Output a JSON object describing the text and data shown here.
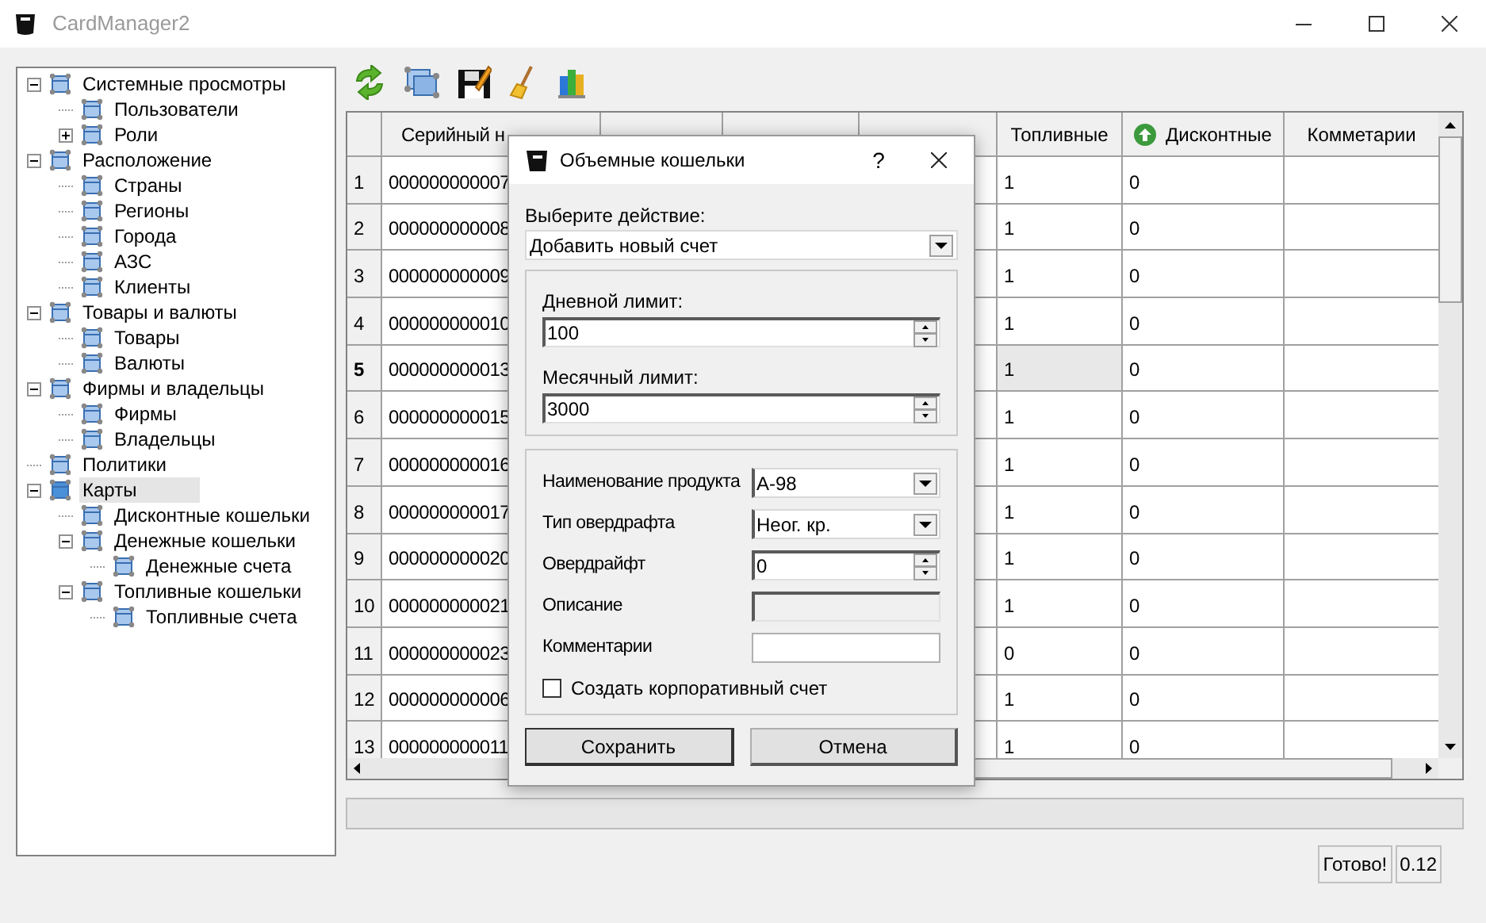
{
  "window": {
    "title": "CardManager2"
  },
  "tree": [
    {
      "label": "Системные просмотры",
      "expanded": true,
      "selected": false,
      "children": [
        {
          "label": "Пользователи",
          "selected": false
        },
        {
          "label": "Роли",
          "expanded": false,
          "selected": false
        }
      ]
    },
    {
      "label": "Расположение",
      "expanded": true,
      "selected": false,
      "children": [
        {
          "label": "Страны",
          "selected": false
        },
        {
          "label": "Регионы",
          "selected": false
        },
        {
          "label": "Города",
          "selected": false
        },
        {
          "label": "АЗС",
          "selected": false
        },
        {
          "label": "Клиенты",
          "selected": false
        }
      ]
    },
    {
      "label": "Товары и валюты",
      "expanded": true,
      "selected": false,
      "children": [
        {
          "label": "Товары",
          "selected": false
        },
        {
          "label": "Валюты",
          "selected": false
        }
      ]
    },
    {
      "label": "Фирмы и владельцы",
      "expanded": true,
      "selected": false,
      "children": [
        {
          "label": "Фирмы",
          "selected": false
        },
        {
          "label": "Владельцы",
          "selected": false
        }
      ]
    },
    {
      "label": "Политики",
      "selected": false
    },
    {
      "label": "Карты",
      "expanded": true,
      "selected": true,
      "children": [
        {
          "label": "Дисконтные кошельки",
          "selected": false
        },
        {
          "label": "Денежные кошельки",
          "expanded": true,
          "selected": false,
          "children": [
            {
              "label": "Денежные счета",
              "selected": false
            }
          ]
        },
        {
          "label": "Топливные кошельки",
          "expanded": true,
          "selected": false,
          "children": [
            {
              "label": "Топливные счета",
              "selected": false
            }
          ]
        }
      ]
    }
  ],
  "table": {
    "columns": [
      {
        "label": "Серийный н",
        "sorted": false
      },
      {
        "label": "Топливные",
        "sorted": false
      },
      {
        "label": "Дисконтные",
        "sorted": true
      },
      {
        "label": "Комметарии",
        "sorted": false
      }
    ],
    "rows": [
      {
        "number": "1",
        "serial": "000000000007",
        "fuel": "1",
        "discount": "0",
        "current": false
      },
      {
        "number": "2",
        "serial": "000000000008",
        "fuel": "1",
        "discount": "0",
        "current": false
      },
      {
        "number": "3",
        "serial": "000000000009",
        "fuel": "1",
        "discount": "0",
        "current": false
      },
      {
        "number": "4",
        "serial": "000000000010",
        "fuel": "1",
        "discount": "0",
        "current": false
      },
      {
        "number": "5",
        "serial": "000000000013",
        "fuel": "1",
        "discount": "0",
        "current": true
      },
      {
        "number": "6",
        "serial": "000000000015",
        "fuel": "1",
        "discount": "0",
        "current": false
      },
      {
        "number": "7",
        "serial": "000000000016",
        "fuel": "1",
        "discount": "0",
        "current": false
      },
      {
        "number": "8",
        "serial": "000000000017",
        "fuel": "1",
        "discount": "0",
        "current": false
      },
      {
        "number": "9",
        "serial": "000000000020",
        "fuel": "1",
        "discount": "0",
        "current": false
      },
      {
        "number": "10",
        "serial": "000000000021",
        "fuel": "1",
        "discount": "0",
        "current": false
      },
      {
        "number": "11",
        "serial": "000000000023",
        "fuel": "0",
        "discount": "0",
        "current": false
      },
      {
        "number": "12",
        "serial": "000000000006",
        "fuel": "1",
        "discount": "0",
        "current": false
      },
      {
        "number": "13",
        "serial": "000000000011",
        "fuel": "1",
        "discount": "0",
        "current": false
      }
    ]
  },
  "dialog": {
    "title": "Объемные кошельки",
    "help": "?",
    "action_label": "Выберите действие:",
    "action": "Добавить новый счет",
    "limits": [
      {
        "label": "Дневной лимит:",
        "value": "100"
      },
      {
        "label": "Месячный лимит:",
        "value": "3000"
      }
    ],
    "fields": [
      {
        "kind": "select",
        "label": "Наименование продукта",
        "value": "А-98",
        "disabled": false
      },
      {
        "kind": "select",
        "label": "Тип овердрафта",
        "value": "Неог. кр.",
        "disabled": false
      },
      {
        "kind": "spin",
        "label": "Овердрайфт",
        "value": "0",
        "disabled": false
      },
      {
        "kind": "text",
        "label": "Описание",
        "disabled": true
      },
      {
        "kind": "text",
        "label": "Комментарии",
        "disabled": false
      }
    ],
    "checkbox": {
      "label": "Создать корпоративный счет",
      "checked": false
    },
    "buttons": [
      "Сохранить",
      "Отмена"
    ]
  },
  "status_bar": {
    "message": "Готово!",
    "version": "0.12"
  }
}
